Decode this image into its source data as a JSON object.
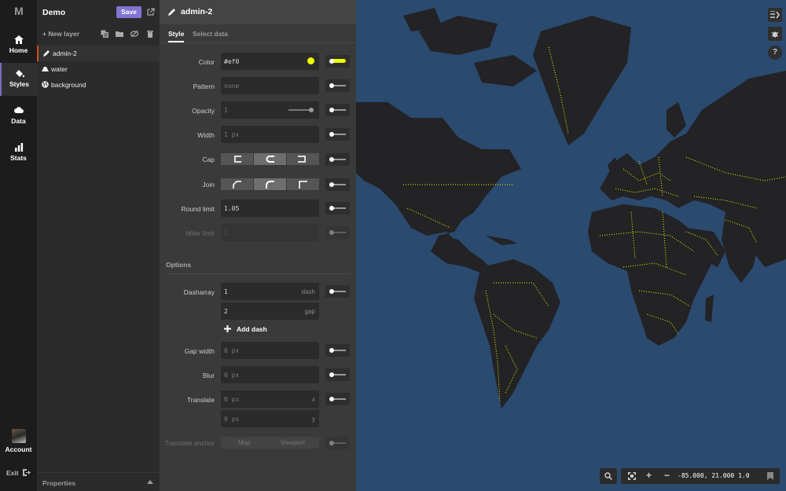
{
  "app": {
    "logo": "M",
    "project_title": "Demo",
    "save_label": "Save"
  },
  "nav": {
    "items": [
      {
        "label": "Home",
        "icon": "home-icon"
      },
      {
        "label": "Styles",
        "icon": "paint-bucket-icon"
      },
      {
        "label": "Data",
        "icon": "cloud-icon"
      },
      {
        "label": "Stats",
        "icon": "bar-chart-icon"
      }
    ],
    "account_label": "Account",
    "exit_label": "Exit"
  },
  "layers": {
    "new_layer_label": "+ New layer",
    "items": [
      {
        "name": "admin-2",
        "icon": "pencil-icon",
        "selected": true
      },
      {
        "name": "water",
        "icon": "shape-icon"
      },
      {
        "name": "background",
        "icon": "globe-icon"
      }
    ],
    "properties_label": "Properties"
  },
  "editor": {
    "layer_title": "admin-2",
    "tabs": [
      {
        "label": "Style"
      },
      {
        "label": "Select data"
      }
    ],
    "properties": {
      "color": {
        "label": "Color",
        "value": "#ef0",
        "swatch": "#eeff00"
      },
      "pattern": {
        "label": "Pattern",
        "placeholder": "none"
      },
      "opacity": {
        "label": "Opacity",
        "placeholder": "1"
      },
      "width": {
        "label": "Width",
        "placeholder": "1 px"
      },
      "cap": {
        "label": "Cap"
      },
      "join": {
        "label": "Join"
      },
      "round_limit": {
        "label": "Round limit",
        "value": "1.05"
      },
      "miter_limit": {
        "label": "Miter limit",
        "placeholder": "2"
      }
    },
    "options_label": "Options",
    "options": {
      "dasharray": {
        "label": "Dasharray",
        "dash_value": "1",
        "dash_unit": "dash",
        "gap_value": "2",
        "gap_unit": "gap"
      },
      "add_dash_label": "Add dash",
      "gap_width": {
        "label": "Gap width",
        "placeholder": "0 px"
      },
      "blur": {
        "label": "Blur",
        "placeholder": "0 px"
      },
      "translate": {
        "label": "Translate",
        "x_placeholder": "0 px",
        "x_unit": "x",
        "y_placeholder": "0 px",
        "y_unit": "y"
      },
      "translate_anchor": {
        "label": "Translate anchor",
        "option_map": "Map",
        "option_viewport": "Viewport"
      }
    }
  },
  "map": {
    "coordinates": "-85.000, 21.000 1.0",
    "colors": {
      "water": "#2a4a6f",
      "land": "#232224",
      "boundary": "#eeff00"
    }
  }
}
